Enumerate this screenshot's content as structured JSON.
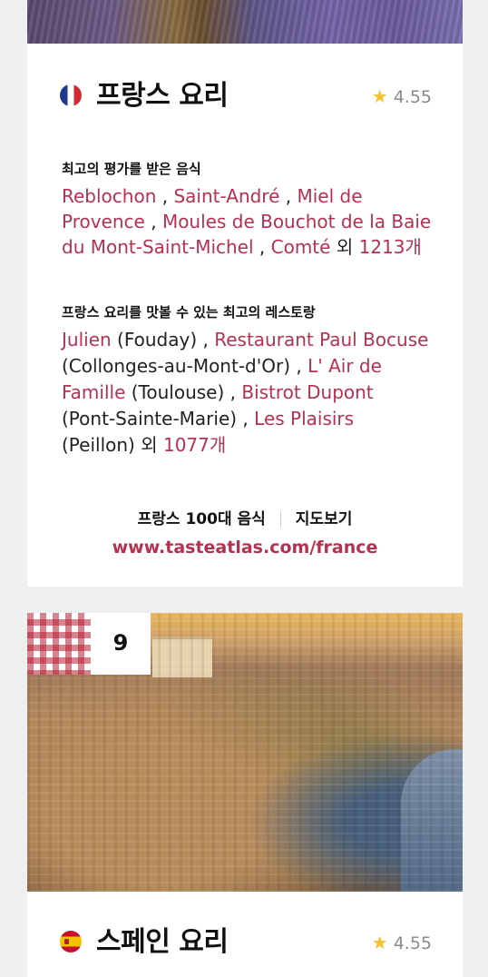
{
  "france": {
    "title": "프랑스 요리",
    "rating": "4.55",
    "top_rated_label": "최고의 평가를 받은 음식",
    "dishes": [
      "Reblochon",
      "Saint-André",
      "Miel de Provence",
      "Moules de Bouchot de la Baie du Mont-Saint-Michel",
      "Comté"
    ],
    "dishes_more_prefix": "외",
    "dishes_more_count": "1213개",
    "restaurants_label": "프랑스 요리를 맛볼 수 있는 최고의 레스토랑",
    "restaurants": [
      {
        "name": "Julien",
        "place": "(Fouday)"
      },
      {
        "name": "Restaurant Paul Bocuse",
        "place": "(Collonges-au-Mont-d'Or)"
      },
      {
        "name": "L' Air de Famille",
        "place": "(Toulouse)"
      },
      {
        "name": "Bistrot Dupont",
        "place": "(Pont-Sainte-Marie)"
      },
      {
        "name": "Les Plaisirs",
        "place": "(Peillon)"
      }
    ],
    "restaurants_more_prefix": "외",
    "restaurants_more_count": "1077개",
    "top100_link": "프랑스 100대 음식",
    "map_link": "지도보기",
    "url": "www.tasteatlas.com/france"
  },
  "spain": {
    "rank": "9",
    "title": "스페인 요리",
    "rating": "4.55"
  },
  "icons": {
    "star": "star-icon",
    "france_flag": "france-flag-icon",
    "spain_flag": "spain-flag-icon"
  },
  "colors": {
    "accent": "#b53150",
    "star": "#f2c230"
  }
}
